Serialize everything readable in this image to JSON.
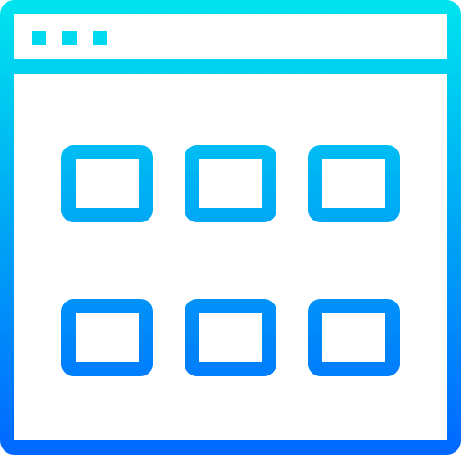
{
  "icon": {
    "name": "browser-grid-window-icon",
    "gradient": {
      "top_color": "#00E4EE",
      "bottom_color": "#0066FF"
    },
    "window_dots": 3,
    "grid": {
      "rows": 2,
      "columns": 3
    }
  }
}
